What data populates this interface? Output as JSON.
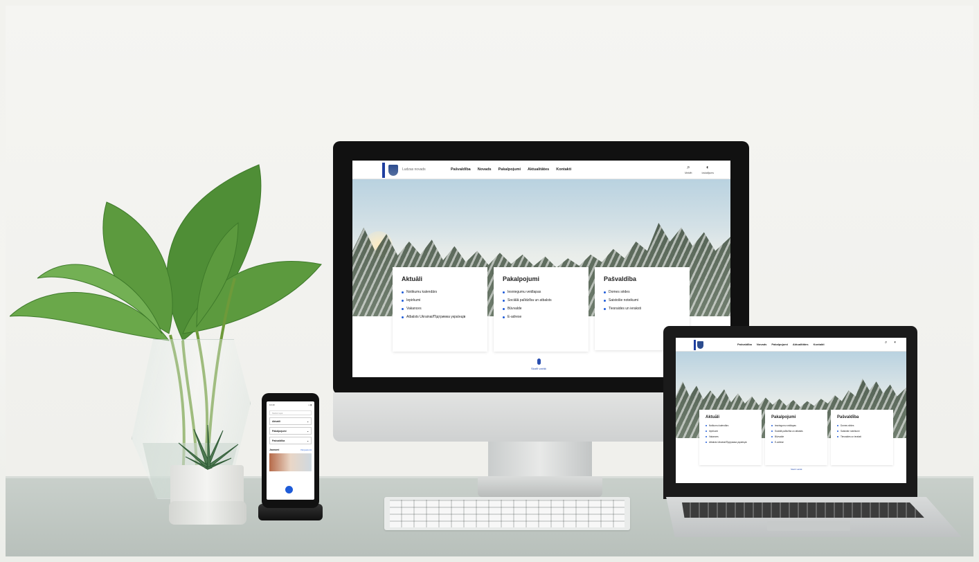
{
  "site": {
    "logo_text": "Ludzas novads",
    "nav": [
      "Pašvaldība",
      "Novads",
      "Pakalpojumi",
      "Aktualitātes",
      "Kontakti"
    ],
    "tools": [
      {
        "glyph": "⌕",
        "label": "Meklēt",
        "icon": "search-icon"
      },
      {
        "glyph": "◐",
        "label": "Izskatījums",
        "icon": "contrast-icon"
      }
    ],
    "cards": [
      {
        "title": "Aktuāli",
        "links": [
          "Notikumu kalendārs",
          "Iepirkumi",
          "Vakances",
          "Atbalsts Ukrainai/Підтримка українців"
        ]
      },
      {
        "title": "Pakalpojumi",
        "links": [
          "Iesniegumu veidlapas",
          "Sociālā palīdzība un atbalsts",
          "Būvvalde",
          "E-adrese"
        ]
      },
      {
        "title": "Pašvaldība",
        "links": [
          "Domes sēdes",
          "Saistošie noteikumi",
          "Tiesraides un ieraksti"
        ]
      }
    ],
    "scroll_label": "Skatīt vairāk"
  },
  "phone": {
    "time": "13:40",
    "signal": "•• ▮",
    "search_placeholder": "Meklēt lapā",
    "accordions": [
      "Aktuāli",
      "Pakalpojumi",
      "Pašvaldība"
    ],
    "section_title": "Jaunumi",
    "section_more": "Visi jaunumi"
  },
  "colors": {
    "accent": "#1e3ea0",
    "link_bullet": "#1e5bd8"
  }
}
